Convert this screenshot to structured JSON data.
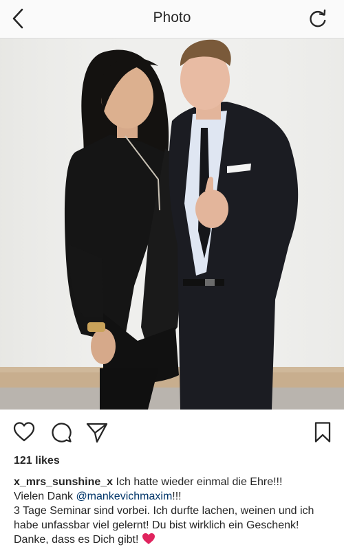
{
  "header": {
    "title": "Photo",
    "back_icon": "chevron-left-icon",
    "refresh_icon": "refresh-icon"
  },
  "post": {
    "image_alt": "Two people posing in front of a white wall, the man giving a thumbs up",
    "actions": {
      "like_icon": "heart-outline-icon",
      "comment_icon": "comment-bubble-icon",
      "share_icon": "paper-plane-icon",
      "save_icon": "bookmark-icon"
    },
    "likes": "121 likes",
    "caption": {
      "username": "x_mrs_sunshine_x",
      "line1": "Ich hatte wieder einmal die Ehre!!!",
      "line2_prefix": "Vielen Dank",
      "mention": "@mankevichmaxim",
      "line2_suffix": "!!!",
      "line3": "3 Tage Seminar sind vorbei. Ich durfte lachen, weinen und ich habe unfassbar viel gelernt! Du bist wirklich ein Geschenk! Danke, dass es Dich gibt!",
      "emoji": "❤️"
    }
  },
  "colors": {
    "text": "#262626",
    "mention": "#003569",
    "header_bg": "#fafafa",
    "divider": "#dbdbdb",
    "heart": "#e0245e"
  }
}
